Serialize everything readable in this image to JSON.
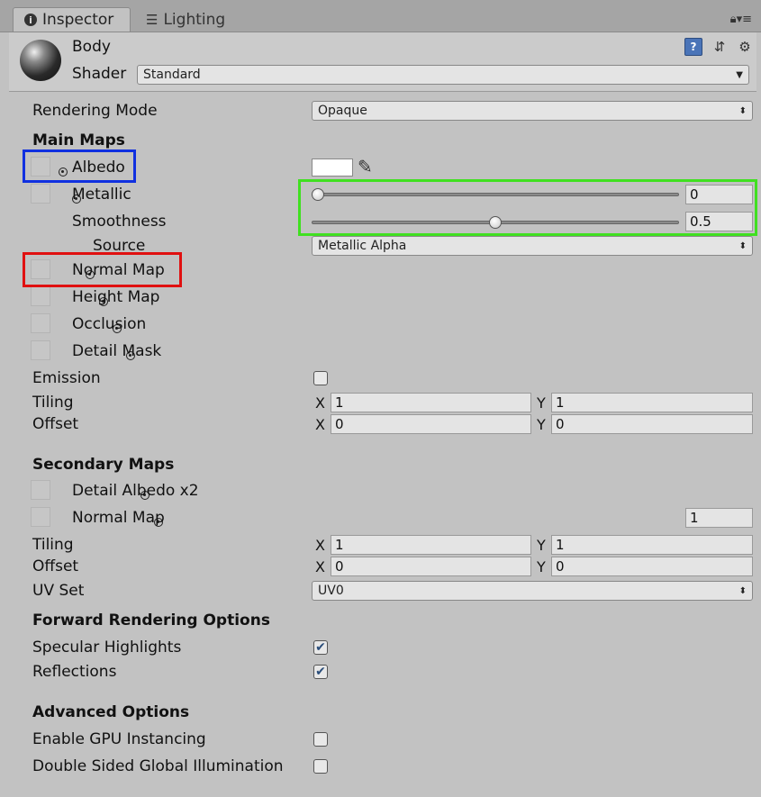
{
  "tabs": [
    {
      "label": "Inspector",
      "icon": "info-icon"
    },
    {
      "label": "Lighting",
      "icon": "sliders-icon"
    }
  ],
  "header": {
    "material_name": "Body",
    "shader_label": "Shader",
    "shader_value": "Standard"
  },
  "rendering_mode": {
    "label": "Rendering Mode",
    "value": "Opaque"
  },
  "main_maps": {
    "title": "Main Maps",
    "albedo": {
      "label": "Albedo",
      "color": "#ffffff"
    },
    "metallic": {
      "label": "Metallic",
      "value": "0",
      "fraction": 0
    },
    "smoothness": {
      "label": "Smoothness",
      "value": "0.5",
      "fraction": 0.5
    },
    "source": {
      "label": "Source",
      "value": "Metallic Alpha"
    },
    "normal_map": {
      "label": "Normal Map"
    },
    "height_map": {
      "label": "Height Map"
    },
    "occlusion": {
      "label": "Occlusion"
    },
    "detail_mask": {
      "label": "Detail Mask"
    },
    "emission": {
      "label": "Emission",
      "checked": false
    },
    "tiling": {
      "label": "Tiling",
      "x": "1",
      "y": "1"
    },
    "offset": {
      "label": "Offset",
      "x": "0",
      "y": "0"
    }
  },
  "axis_labels": {
    "x": "X",
    "y": "Y"
  },
  "secondary_maps": {
    "title": "Secondary Maps",
    "detail_albedo": {
      "label": "Detail Albedo x2"
    },
    "normal_map": {
      "label": "Normal Map",
      "value": "1"
    },
    "tiling": {
      "label": "Tiling",
      "x": "1",
      "y": "1"
    },
    "offset": {
      "label": "Offset",
      "x": "0",
      "y": "0"
    },
    "uv_set": {
      "label": "UV Set",
      "value": "UV0"
    }
  },
  "forward_rendering": {
    "title": "Forward Rendering Options",
    "specular": {
      "label": "Specular Highlights",
      "checked": true
    },
    "reflections": {
      "label": "Reflections",
      "checked": true
    }
  },
  "advanced": {
    "title": "Advanced Options",
    "gpu_instancing": {
      "label": "Enable GPU Instancing",
      "checked": false
    },
    "double_sided_gi": {
      "label": "Double Sided Global Illumination",
      "checked": false
    }
  },
  "highlights": {
    "blue": "#1030e0",
    "red": "#e01010",
    "green": "#40e020"
  }
}
